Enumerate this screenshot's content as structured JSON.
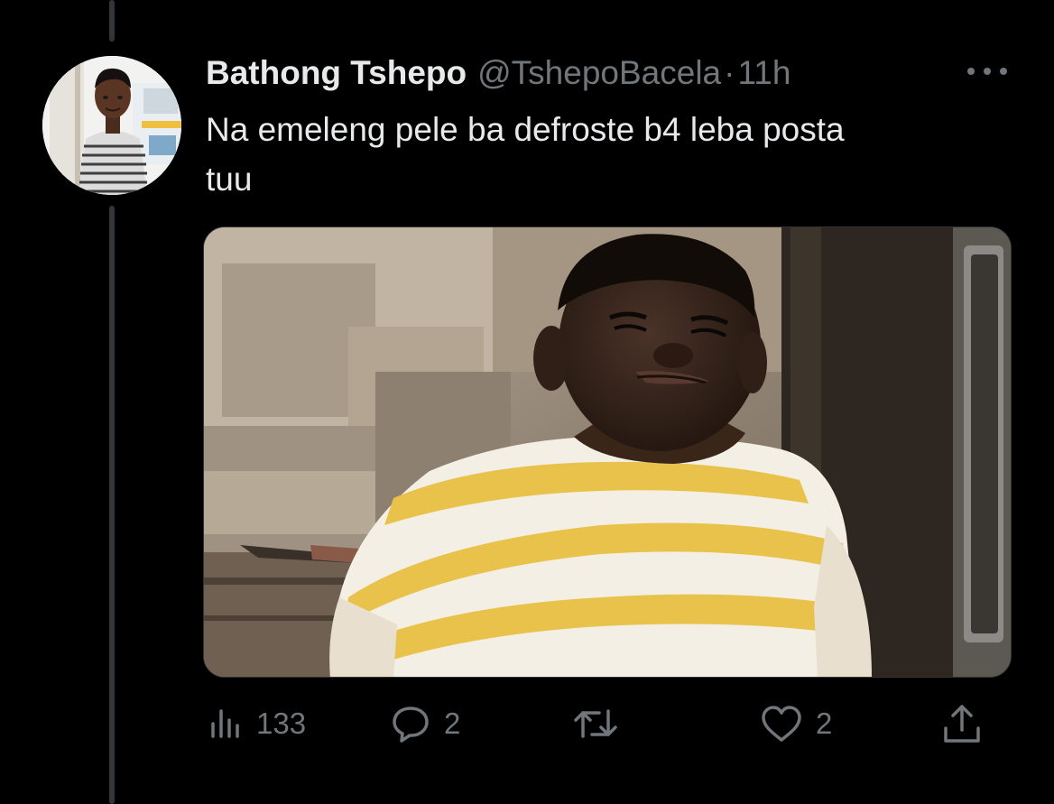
{
  "tweet": {
    "display_name": "Bathong Tshepo",
    "handle": "@TshepoBacela",
    "separator": "·",
    "time": "11h",
    "text": "Na emeleng pele ba defroste b4 leba posta\ntuu"
  },
  "actions": {
    "views_count": "133",
    "replies_count": "2",
    "retweets_count": "",
    "likes_count": "2"
  },
  "icons": {
    "views": "bar-chart-icon",
    "reply": "speech-bubble-icon",
    "retweet": "retweet-arrows-icon",
    "like": "heart-icon",
    "share": "upload-share-icon",
    "more": "ellipsis-icon"
  },
  "colors": {
    "background": "#000000",
    "primary_text": "#e7e9ea",
    "secondary_text": "#71767b",
    "thread_line": "#333639"
  }
}
